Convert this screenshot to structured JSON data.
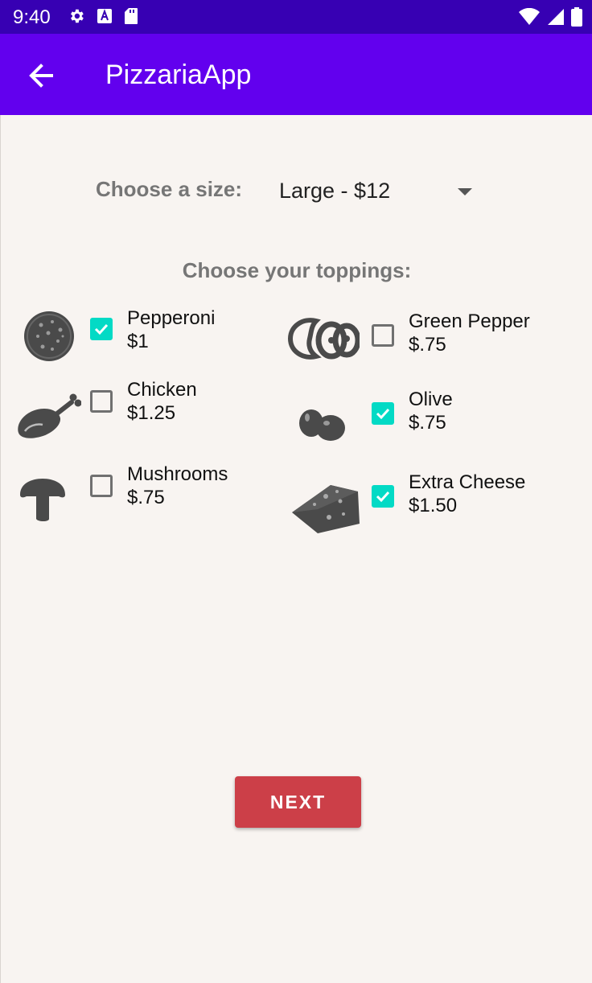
{
  "status_bar": {
    "time": "9:40"
  },
  "app_bar": {
    "title": "PizzariaApp"
  },
  "size": {
    "label": "Choose a size:",
    "selected": "Large - $12"
  },
  "toppings": {
    "label": "Choose your toppings:",
    "items": [
      {
        "name": "Pepperoni",
        "price": "$1",
        "checked": true,
        "icon": "pepperoni-icon"
      },
      {
        "name": "Chicken",
        "price": "$1.25",
        "checked": false,
        "icon": "chicken-leg-icon"
      },
      {
        "name": "Mushrooms",
        "price": "$.75",
        "checked": false,
        "icon": "mushroom-icon"
      },
      {
        "name": "Green Pepper",
        "price": "$.75",
        "checked": false,
        "icon": "green-pepper-icon"
      },
      {
        "name": "Olive",
        "price": "$.75",
        "checked": true,
        "icon": "olive-icon"
      },
      {
        "name": "Extra Cheese",
        "price": "$1.50",
        "checked": true,
        "icon": "cheese-icon"
      }
    ]
  },
  "next_button": {
    "label": "NEXT"
  },
  "colors": {
    "status_bar": "#3700b3",
    "app_bar": "#6200ee",
    "checkbox_checked": "#03dac5",
    "next_button": "#cc3f48",
    "background": "#f8f4f1"
  }
}
